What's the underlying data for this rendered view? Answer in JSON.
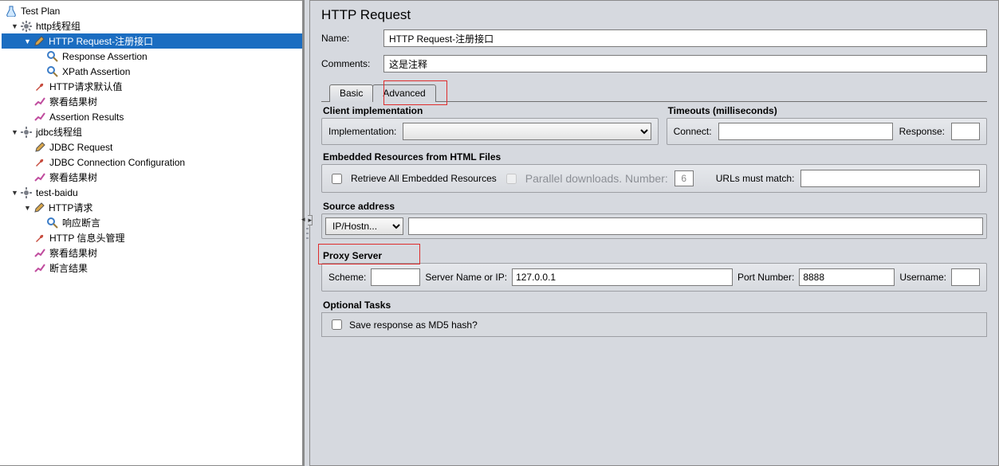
{
  "tree": {
    "root": "Test Plan",
    "n1": "http线程组",
    "n1_1": "HTTP Request-注册接口",
    "n1_1_1": "Response Assertion",
    "n1_1_2": "XPath Assertion",
    "n1_2": "HTTP请求默认值",
    "n1_3": "察看结果树",
    "n1_4": "Assertion Results",
    "n2": "jdbc线程组",
    "n2_1": "JDBC Request",
    "n2_2": "JDBC Connection Configuration",
    "n2_3": "察看结果树",
    "n3": "test-baidu",
    "n3_1": "HTTP请求",
    "n3_1_1": "响应断言",
    "n3_2": "HTTP 信息头管理",
    "n3_3": "察看结果树",
    "n3_4": "断言结果"
  },
  "panel": {
    "title": "HTTP Request",
    "name_label": "Name:",
    "name_value": "HTTP Request-注册接口",
    "comments_label": "Comments:",
    "comments_value": "这是注释",
    "tabs": {
      "basic": "Basic",
      "advanced": "Advanced"
    }
  },
  "client_impl": {
    "title": "Client implementation",
    "label": "Implementation:",
    "value": ""
  },
  "timeouts": {
    "title": "Timeouts (milliseconds)",
    "connect_label": "Connect:",
    "connect_value": "",
    "response_label": "Response:",
    "response_value": ""
  },
  "embedded": {
    "title": "Embedded Resources from HTML Files",
    "retrieve_label": "Retrieve All Embedded Resources",
    "parallel_label": "Parallel downloads. Number:",
    "parallel_number": "6",
    "urls_match_label": "URLs must match:",
    "urls_match_value": ""
  },
  "source": {
    "title": "Source address",
    "type": "IP/Hostn...",
    "value": ""
  },
  "proxy": {
    "title": "Proxy Server",
    "scheme_label": "Scheme:",
    "scheme_value": "",
    "server_label": "Server Name or IP:",
    "server_value": "127.0.0.1",
    "port_label": "Port Number:",
    "port_value": "8888",
    "user_label": "Username:",
    "user_value": ""
  },
  "optional": {
    "title": "Optional Tasks",
    "md5_label": "Save response as MD5 hash?"
  }
}
